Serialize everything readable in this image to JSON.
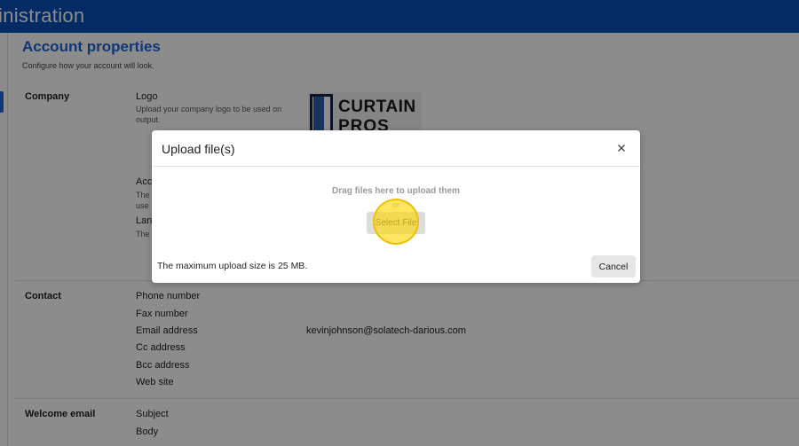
{
  "topbar": {
    "title": "inistration"
  },
  "page": {
    "title": "Account properties",
    "subtitle": "Configure how your account will look."
  },
  "company": {
    "label": "Company",
    "logo_label": "Logo",
    "logo_desc": "Upload your company logo to be used on output.",
    "logo_text_line1": "CURTAIN",
    "logo_text_line2": "PROS",
    "field_partial_1": "Acc",
    "field_partial_1_desc_a": "The",
    "field_partial_1_desc_b": "use",
    "field_partial_2": "Lan",
    "field_partial_2_desc": "The"
  },
  "contact": {
    "label": "Contact",
    "fields": [
      "Phone number",
      "Fax number",
      "Email address",
      "Cc address",
      "Bcc address",
      "Web site"
    ],
    "email_value": "kevinjohnson@solatech-darious.com"
  },
  "welcome": {
    "label": "Welcome email",
    "fields": [
      "Subject",
      "Body"
    ]
  },
  "modal": {
    "title": "Upload file(s)",
    "drop_hint": "Drag files here to upload them",
    "or": "or",
    "select_button": "Select File",
    "max_size": "The maximum upload size is 25 MB.",
    "cancel_button": "Cancel"
  },
  "colors": {
    "header": "#0a4fb8",
    "accent": "#1f63d6",
    "highlight": "#ffd600"
  }
}
